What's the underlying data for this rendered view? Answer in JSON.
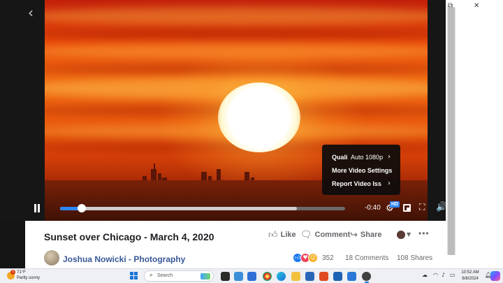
{
  "window": {
    "minimize_icon": "restore-icon",
    "close_glyph": "✕",
    "restore_glyph": "⧉"
  },
  "viewer": {
    "back_glyph": "‹"
  },
  "settings_menu": {
    "quality_label": "Quali",
    "quality_value": "Auto 1080p",
    "more_settings": "More Video Settings",
    "report": "Report Video Iss",
    "chevron": "›"
  },
  "player": {
    "progress_played": 0.077,
    "progress_buffered": 0.83,
    "time_remaining": "-0:40",
    "hd_badge": "HD",
    "gear_glyph": "⚙",
    "fullscreen_glyph": "⛶",
    "volume_glyph": "🔊"
  },
  "post": {
    "title": "Sunset over Chicago - March 4, 2020",
    "like_label": "Like",
    "comment_label": "Comment",
    "share_label": "Share",
    "more_glyph": "•••",
    "caret_glyph": "▼",
    "author": "Joshua Nowicki - Photography",
    "reaction_count": "352",
    "comments": "18 Comments",
    "shares": "108 Shares"
  },
  "colors": {
    "accent": "#2d88ff",
    "link": "#385898",
    "like_reaction": "#1877f2",
    "love_reaction": "#f33e58",
    "wow_reaction": "#f7b125"
  },
  "taskbar": {
    "temperature": "71°F",
    "condition": "Partly sunny",
    "weather_badge": "1",
    "search_placeholder": "Search",
    "time": "10:52 AM",
    "date": "6/8/2024"
  }
}
